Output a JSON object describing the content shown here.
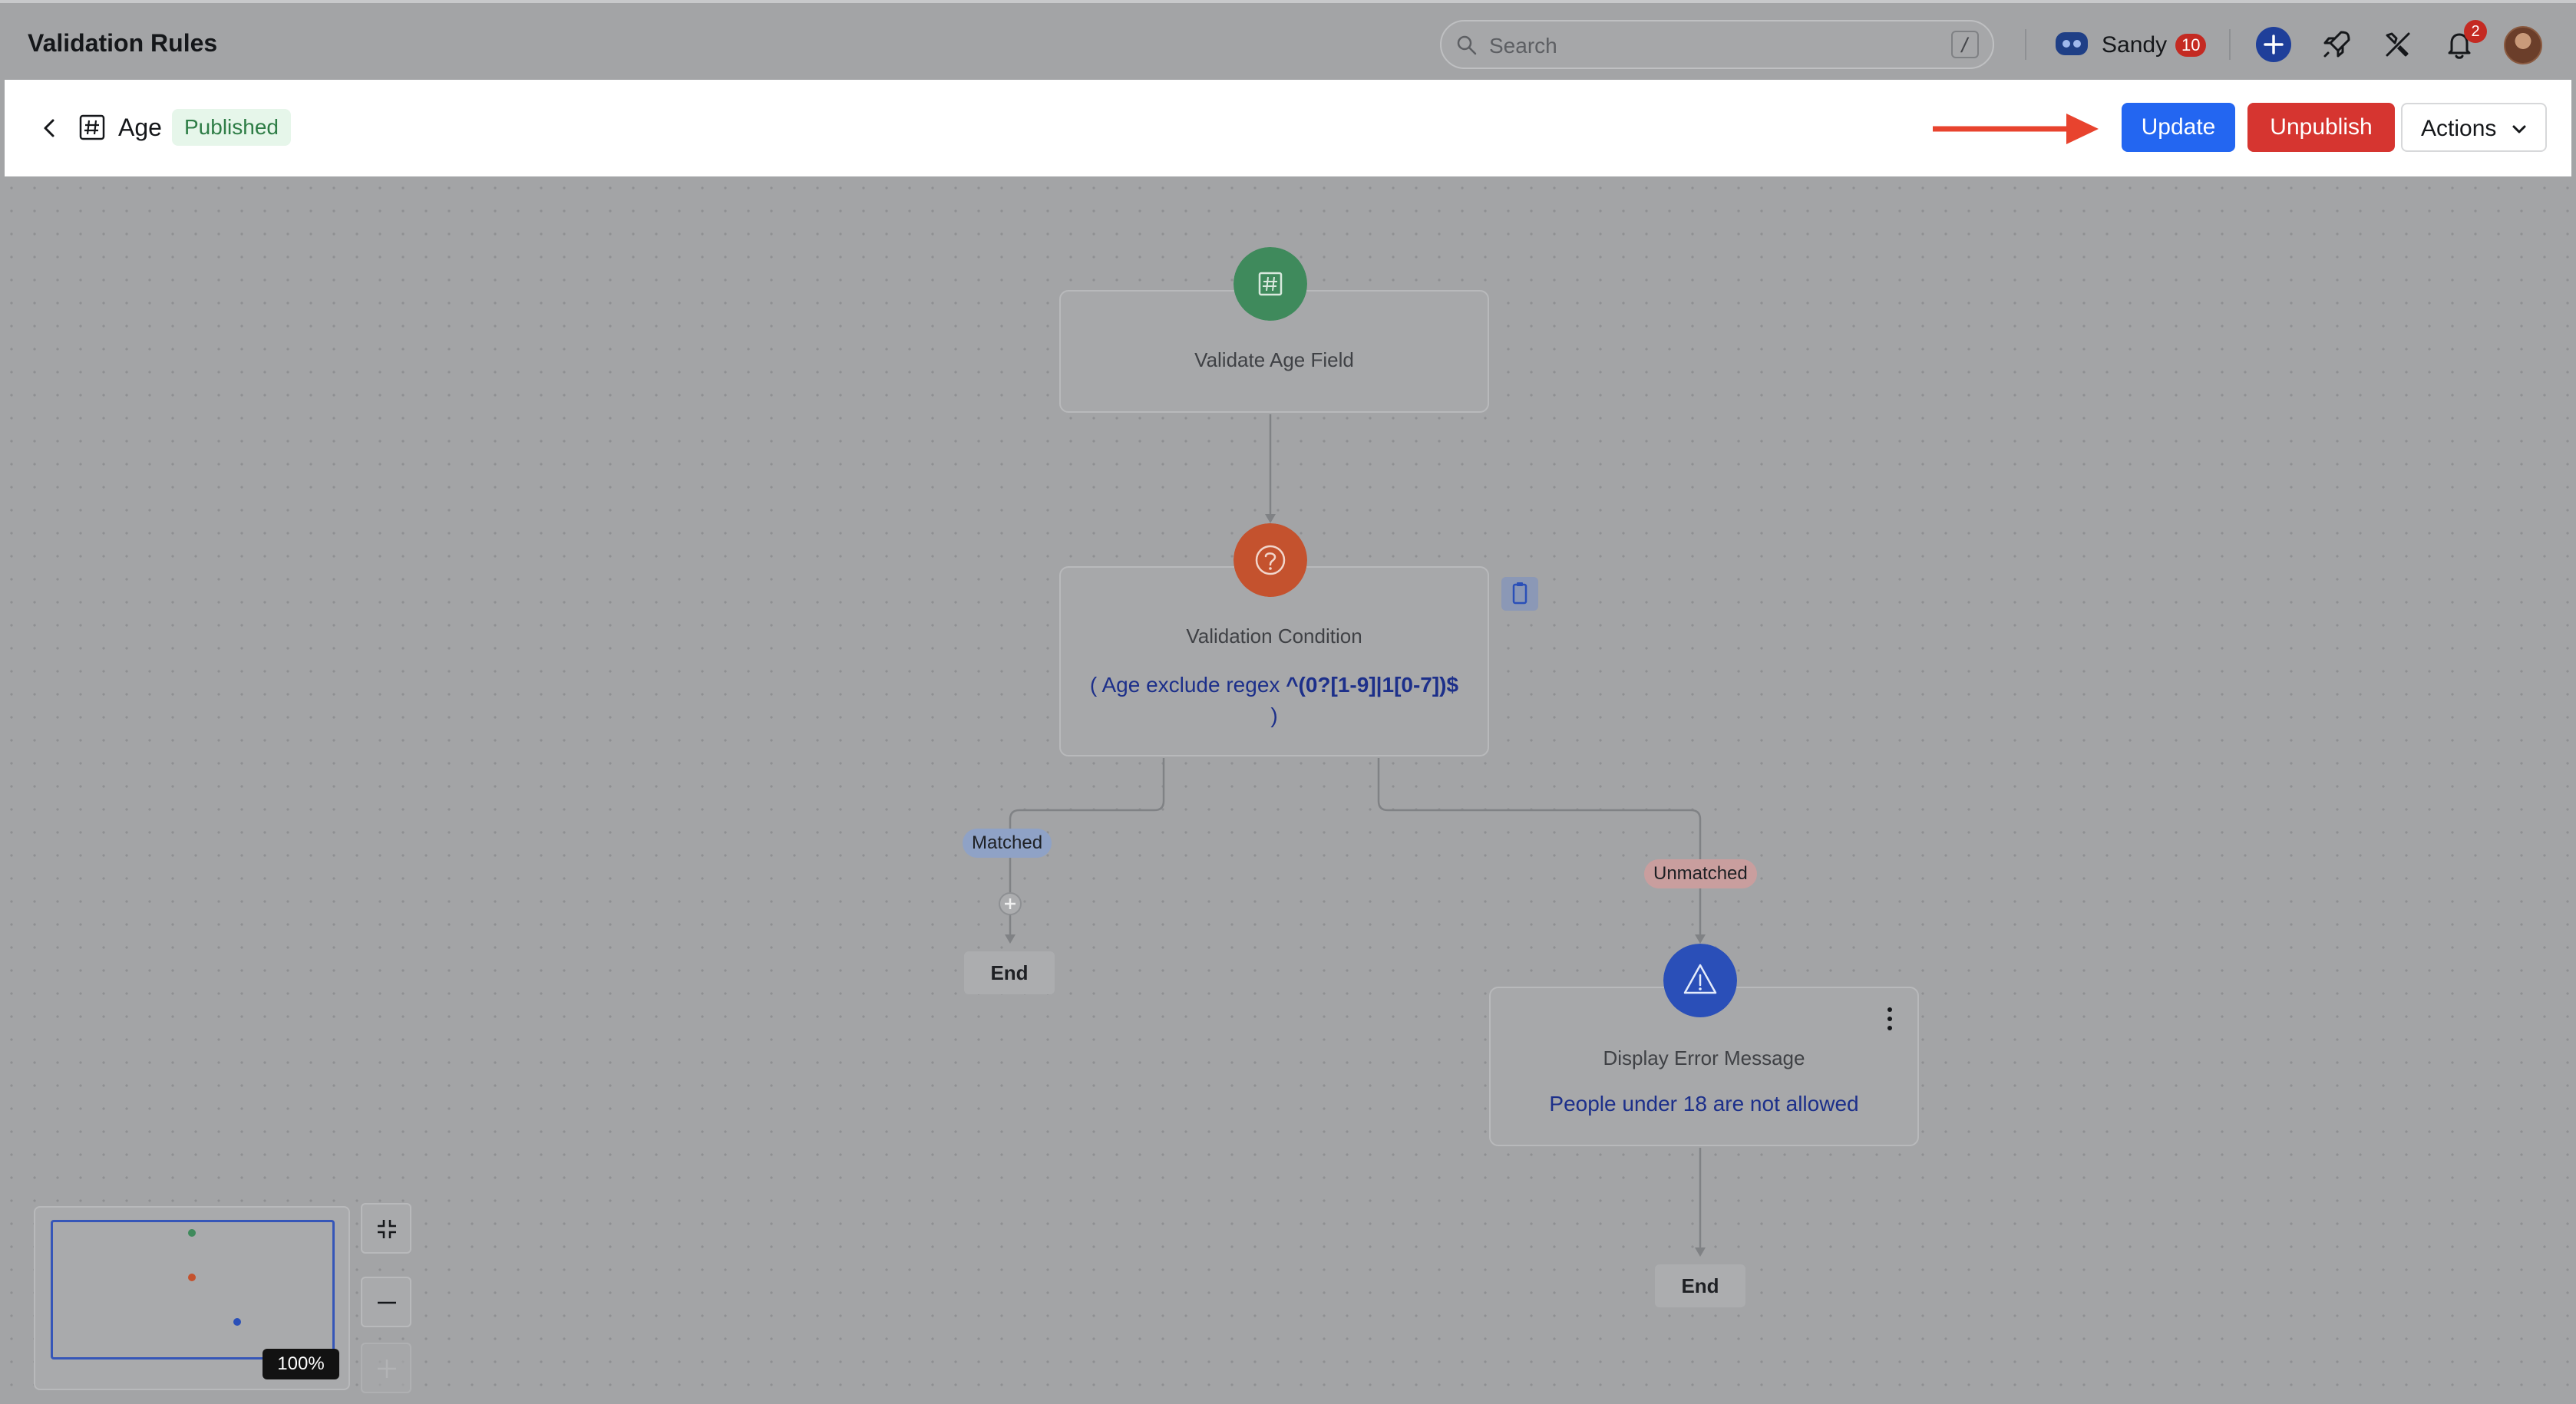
{
  "app": {
    "title": "Validation Rules"
  },
  "search": {
    "placeholder": "Search",
    "shortcut": "/"
  },
  "user": {
    "name": "Sandy",
    "count": "10"
  },
  "notifications": {
    "count": "2"
  },
  "subheader": {
    "field_name": "Age",
    "status": "Published",
    "update_label": "Update",
    "unpublish_label": "Unpublish",
    "actions_label": "Actions"
  },
  "flow": {
    "trigger": {
      "title": "Validate Age Field"
    },
    "condition": {
      "title": "Validation Condition",
      "prefix": "( Age exclude regex ",
      "regex": "^(0?[1-9]|1[0-7])$",
      "suffix": " )"
    },
    "branches": {
      "matched": "Matched",
      "unmatched": "Unmatched"
    },
    "action": {
      "title": "Display Error Message",
      "message": "People under 18 are not allowed"
    },
    "end_label": "End"
  },
  "minimap": {
    "zoom": "100%"
  },
  "colors": {
    "primary": "#2366f1",
    "danger": "#d63530",
    "trigger_node": "#3f8a5c",
    "condition_node": "#c4522e",
    "action_node": "#2a4fb8",
    "annotation_arrow": "#e8432e"
  }
}
